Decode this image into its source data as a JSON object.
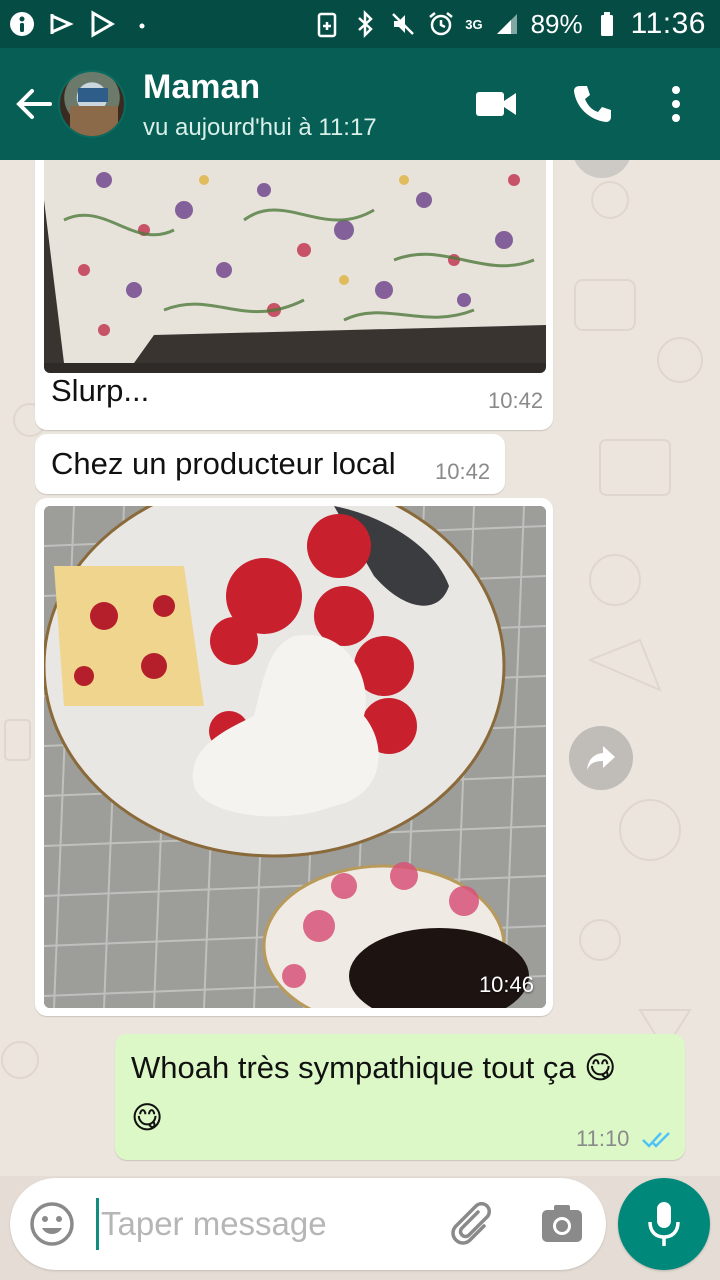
{
  "status_bar": {
    "battery": "89%",
    "time": "11:36",
    "network": "3G",
    "signal_flag": "R"
  },
  "header": {
    "contact_name": "Maman",
    "last_seen": "vu aujourd'hui à 11:17",
    "icons": [
      "back-arrow-icon",
      "video-call-icon",
      "phone-icon",
      "more-vert-icon"
    ]
  },
  "messages": [
    {
      "type": "image",
      "caption": "Slurp...",
      "time": "10:42",
      "direction": "in"
    },
    {
      "type": "text",
      "text": "Chez un producteur local",
      "time": "10:42",
      "direction": "in"
    },
    {
      "type": "image",
      "time": "10:46",
      "direction": "in"
    },
    {
      "type": "text",
      "text": "Whoah très sympathique tout ça 😋",
      "emoji_line": "😋",
      "time": "11:10",
      "direction": "out",
      "status": "read"
    }
  ],
  "composer": {
    "placeholder": "Taper message",
    "value": ""
  },
  "colors": {
    "header": "#075e54",
    "status_bar": "#054d44",
    "outgoing_bubble": "#dcf8c6",
    "incoming_bubble": "#ffffff",
    "read_ticks": "#4fc3f7",
    "mic_button": "#00897b"
  }
}
